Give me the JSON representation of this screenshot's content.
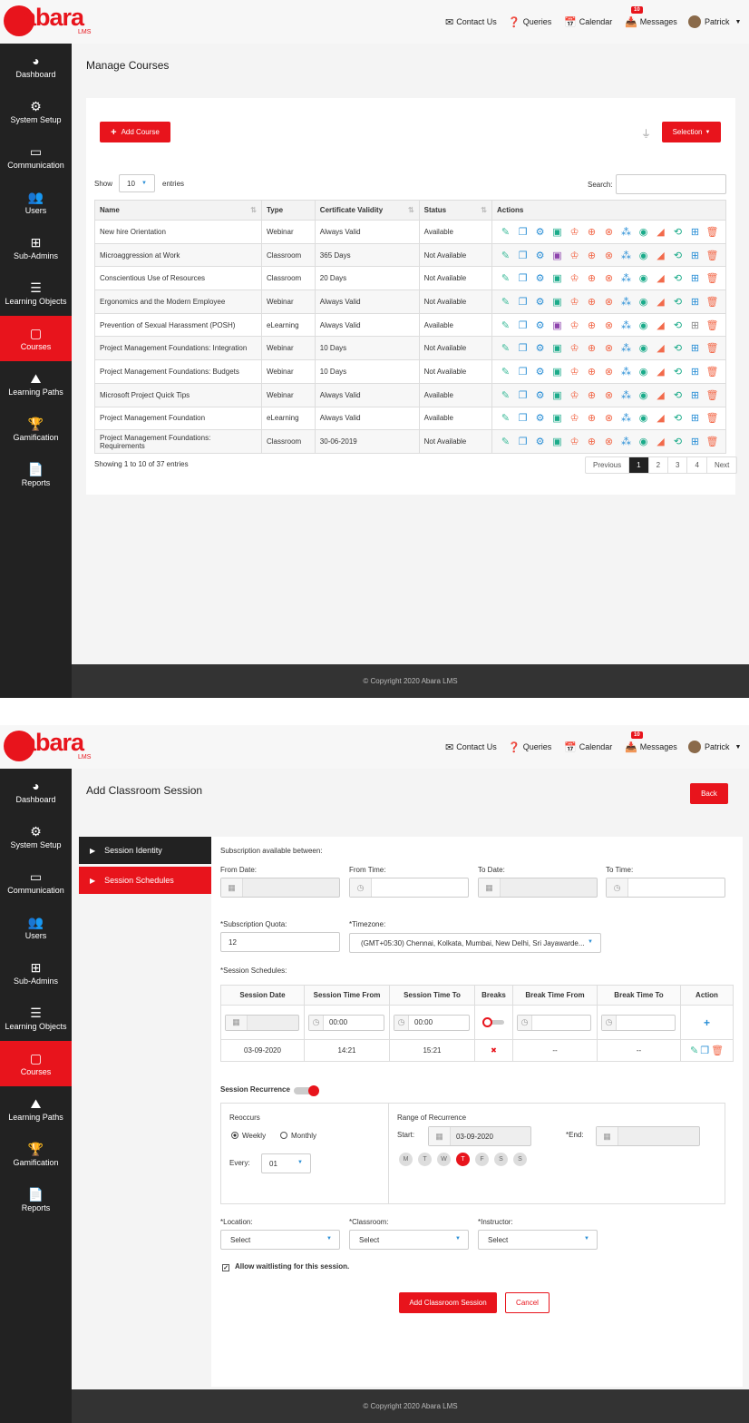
{
  "brand": {
    "logo_text": "abara",
    "logo_sub": "LMS"
  },
  "topnav": {
    "contact": "Contact Us",
    "queries": "Queries",
    "calendar": "Calendar",
    "messages": "Messages",
    "messages_count": "10",
    "user": "Patrick"
  },
  "sidebar": [
    {
      "label": "Dashboard",
      "icon": "dashboard-icon"
    },
    {
      "label": "System Setup",
      "icon": "gear-icon"
    },
    {
      "label": "Communication",
      "icon": "inbox-icon"
    },
    {
      "label": "Users",
      "icon": "users-icon"
    },
    {
      "label": "Sub-Admins",
      "icon": "sitemap-icon"
    },
    {
      "label": "Learning Objects",
      "icon": "server-icon"
    },
    {
      "label": "Courses",
      "icon": "monitor-icon"
    },
    {
      "label": "Learning Paths",
      "icon": "road-icon"
    },
    {
      "label": "Gamification",
      "icon": "trophy-icon"
    },
    {
      "label": "Reports",
      "icon": "report-icon"
    }
  ],
  "footer": "© Copyright 2020 Abara LMS",
  "manage": {
    "title": "Manage Courses",
    "add_button": "Add Course",
    "selection_button": "Selection",
    "show_label": "Show",
    "entries_value": "10",
    "entries_label": "entries",
    "search_label": "Search:",
    "columns": [
      "Name",
      "Type",
      "Certificate Validity",
      "Status",
      "Actions"
    ],
    "rows": [
      [
        "New hire Orientation",
        "Webinar",
        "Always Valid",
        "Available"
      ],
      [
        "Microaggression at Work",
        "Classroom",
        "365 Days",
        "Not Available"
      ],
      [
        "Conscientious Use of Resources",
        "Classroom",
        "20 Days",
        "Not Available"
      ],
      [
        "Ergonomics and the Modern Employee",
        "Webinar",
        "Always Valid",
        "Not Available"
      ],
      [
        "Prevention of Sexual Harassment (POSH)",
        "eLearning",
        "Always Valid",
        "Available"
      ],
      [
        "Project Management Foundations: Integration",
        "Webinar",
        "10 Days",
        "Not Available"
      ],
      [
        "Project Management Foundations: Budgets",
        "Webinar",
        "10 Days",
        "Not Available"
      ],
      [
        "Microsoft Project Quick Tips",
        "Webinar",
        "Always Valid",
        "Available"
      ],
      [
        "Project Management Foundation",
        "eLearning",
        "Always Valid",
        "Available"
      ],
      [
        "Project Management Foundations: Requirements",
        "Classroom",
        "30-06-2019",
        "Not Available"
      ]
    ],
    "showing": "Showing 1 to 10 of 37 entries",
    "pagination": [
      "Previous",
      "1",
      "2",
      "3",
      "4",
      "Next"
    ]
  },
  "session": {
    "title": "Add Classroom Session",
    "back": "Back",
    "tabs": [
      "Session Identity",
      "Session Schedules"
    ],
    "subscription_heading": "Subscription available between:",
    "from_date": "From Date:",
    "from_time": "From Time:",
    "to_date": "To Date:",
    "to_time": "To Time:",
    "quota_label": "*Subscription Quota:",
    "quota_value": "12",
    "timezone_label": "*Timezone:",
    "timezone_value": "(GMT+05:30) Chennai, Kolkata, Mumbai, New Delhi, Sri Jayawarde...",
    "schedules_heading": "*Session Schedules:",
    "sched_columns": [
      "Session Date",
      "Session Time From",
      "Session Time To",
      "Breaks",
      "Break Time From",
      "Break Time To",
      "Action"
    ],
    "time_from_value": "00:00",
    "time_to_value": "00:00",
    "row": {
      "date": "03-09-2020",
      "from": "14:21",
      "to": "15:21",
      "breaks": "✖",
      "bfrom": "--",
      "bto": "--"
    },
    "recurrence_label": "Session Recurrence",
    "reoccurs": "Reoccurs",
    "weekly": "Weekly",
    "monthly": "Monthly",
    "every": "Every:",
    "every_value": "01",
    "range": "Range of Recurrence",
    "start": "Start:",
    "start_value": "03-09-2020",
    "end": "*End:",
    "days": [
      "M",
      "T",
      "W",
      "T",
      "F",
      "S",
      "S"
    ],
    "location_label": "*Location:",
    "classroom_label": "*Classroom:",
    "instructor_label": "*Instructor:",
    "select": "Select",
    "waitlist": "Allow waitlisting for this session.",
    "submit": "Add Classroom Session",
    "cancel": "Cancel"
  },
  "colors": {
    "accent": "#e8141c",
    "sidebar": "#222222"
  }
}
